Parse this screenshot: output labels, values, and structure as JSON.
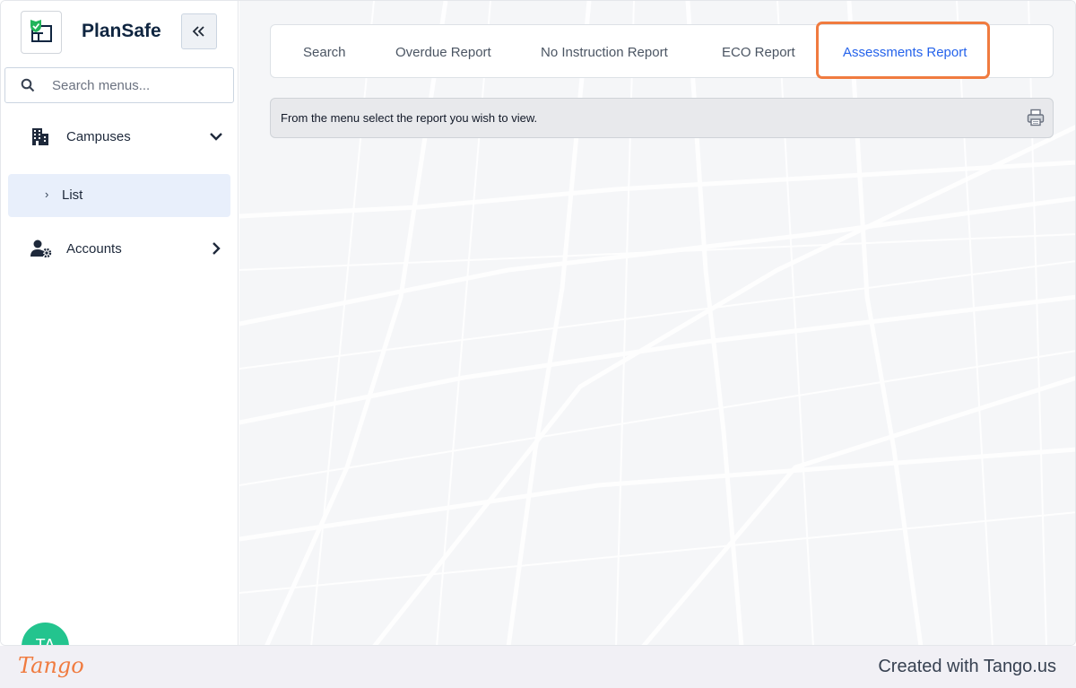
{
  "app": {
    "brand": "PlanSafe"
  },
  "sidebar": {
    "search_placeholder": "Search menus...",
    "items": [
      {
        "label": "Campuses",
        "icon": "building-icon",
        "expanded": true
      },
      {
        "label": "Accounts",
        "icon": "user-gear-icon",
        "expanded": false
      }
    ],
    "sub_items": [
      {
        "label": "List",
        "parent": "Campuses",
        "active": true
      }
    ]
  },
  "user": {
    "initials": "TA"
  },
  "tabs": [
    {
      "label": "Search"
    },
    {
      "label": "Overdue Report"
    },
    {
      "label": "No Instruction Report"
    },
    {
      "label": "ECO Report"
    },
    {
      "label": "Assessments Report",
      "active": true
    }
  ],
  "message": {
    "text": "From the menu select the report you wish to view."
  },
  "footer": {
    "logo": "Tango",
    "credit": "Created with Tango.us"
  },
  "colors": {
    "accent": "#2563eb",
    "highlight": "#f07b3f",
    "brand_text": "#0f2540",
    "avatar": "#23c48e"
  }
}
